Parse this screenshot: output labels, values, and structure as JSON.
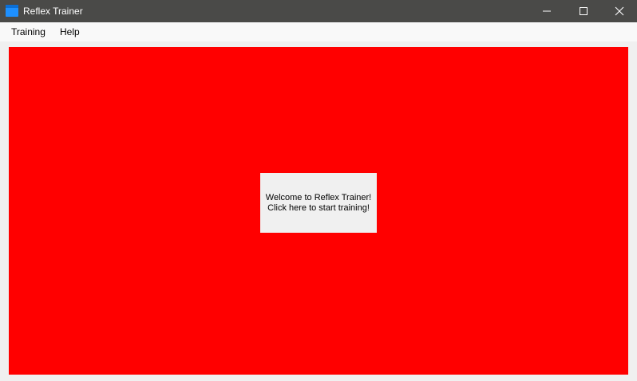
{
  "window": {
    "title": "Reflex Trainer",
    "icon": "app-icon",
    "controls": {
      "minimize_icon": "minimize-icon",
      "maximize_icon": "maximize-icon",
      "close_icon": "close-icon"
    }
  },
  "menubar": {
    "items": [
      {
        "label": "Training"
      },
      {
        "label": "Help"
      }
    ]
  },
  "panel": {
    "background_color": "#ff0000",
    "start_button": {
      "line1": "Welcome to Reflex Trainer!",
      "line2": "Click here to start training!"
    }
  },
  "colors": {
    "titlebar": "#4a4a48",
    "panel": "#ff0000",
    "button": "#f0f0f0"
  }
}
